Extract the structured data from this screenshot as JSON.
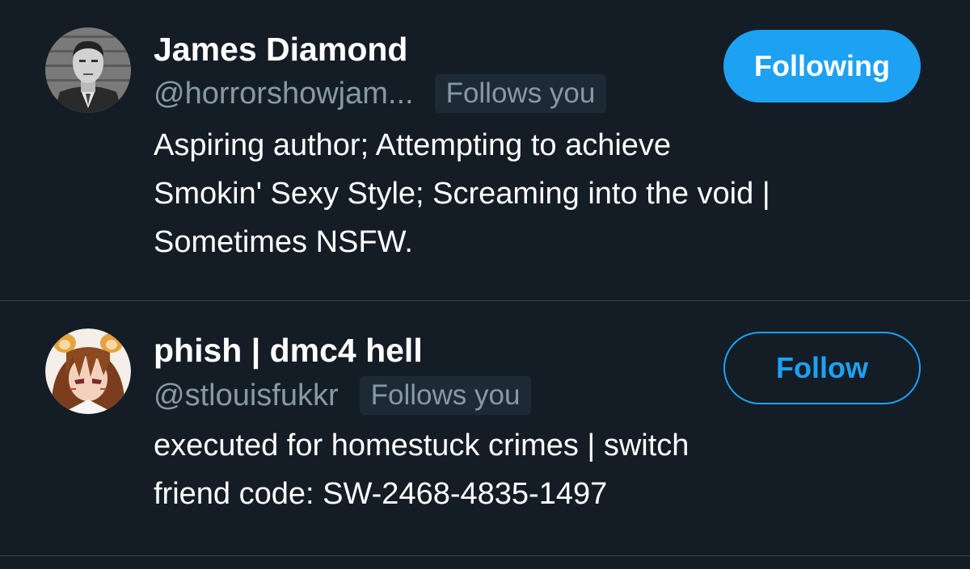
{
  "theme": {
    "background": "#141d26",
    "primary_text": "#ffffff",
    "secondary_text": "#8899a6",
    "accent": "#1da1f2",
    "divider": "#38444d",
    "badge_bg": "#1d2a35"
  },
  "users": [
    {
      "display_name": "James Diamond",
      "handle": "@horrorshowjam...",
      "follows_you_label": "Follows you",
      "bio_lines": [
        "Aspiring author; Attempting to achieve",
        "Smokin' Sexy Style; Screaming into the void |",
        "Sometimes NSFW."
      ],
      "button_label": "Following",
      "button_state": "following",
      "avatar_icon": "grayscale-portrait-avatar"
    },
    {
      "display_name": "phish | dmc4 hell",
      "handle": "@stlouisfukkr",
      "follows_you_label": "Follows you",
      "bio_lines": [
        "executed for homestuck crimes | switch",
        "friend code: SW-2468-4835-1497"
      ],
      "button_label": "Follow",
      "button_state": "not-following",
      "avatar_icon": "anime-character-avatar"
    }
  ]
}
